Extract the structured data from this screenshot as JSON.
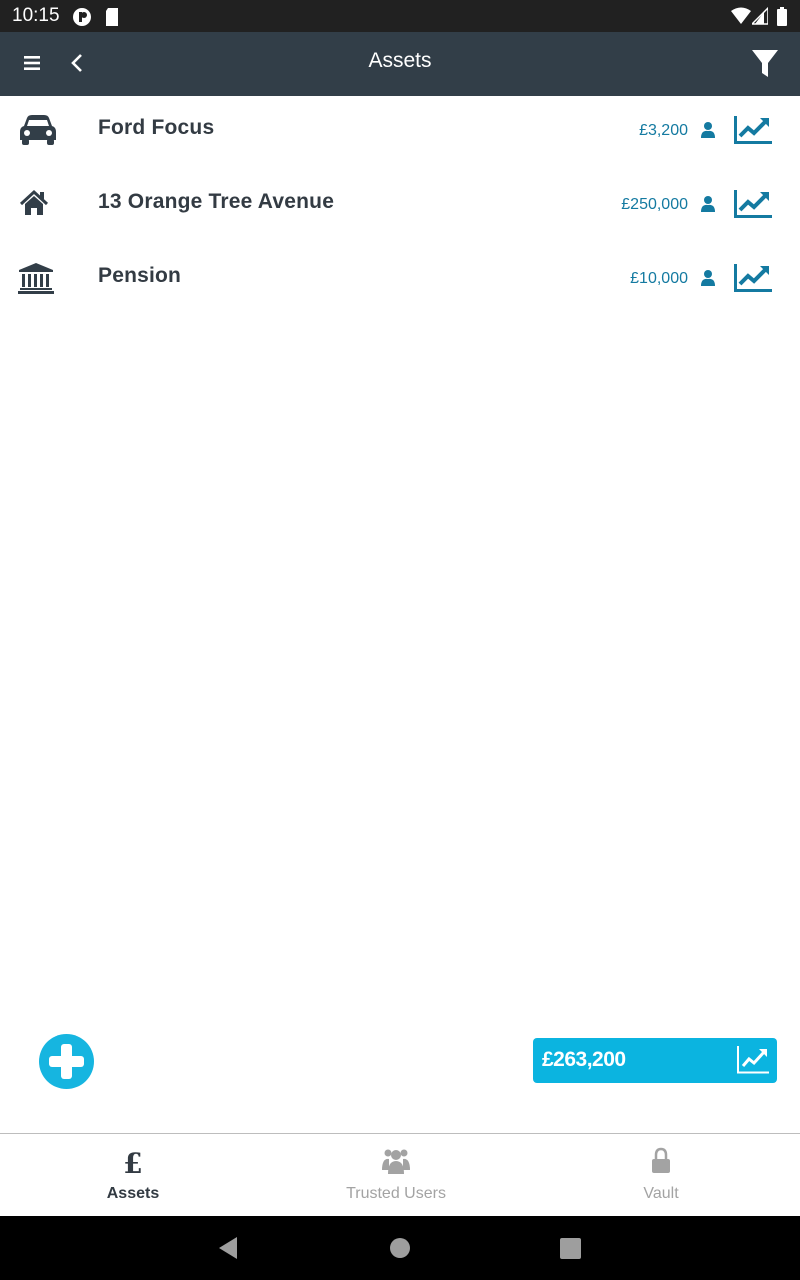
{
  "status_bar": {
    "time": "10:15"
  },
  "app_bar": {
    "title": "Assets"
  },
  "assets": [
    {
      "name": "Ford Focus",
      "value": "£3,200",
      "icon": "car-icon"
    },
    {
      "name": "13 Orange Tree Avenue",
      "value": "£250,000",
      "icon": "home-icon"
    },
    {
      "name": "Pension",
      "value": "£10,000",
      "icon": "bank-icon"
    }
  ],
  "total": {
    "amount": "£263,200"
  },
  "tabs": [
    {
      "label": "Assets",
      "icon": "pound-icon",
      "active": true
    },
    {
      "label": "Trusted Users",
      "icon": "users-icon",
      "active": false
    },
    {
      "label": "Vault",
      "icon": "lock-icon",
      "active": false
    }
  ],
  "colors": {
    "app_bar": "#323e48",
    "accent": "#0bb4e0",
    "value_text": "#147aa1",
    "inactive_tab": "#a3a3a3"
  }
}
